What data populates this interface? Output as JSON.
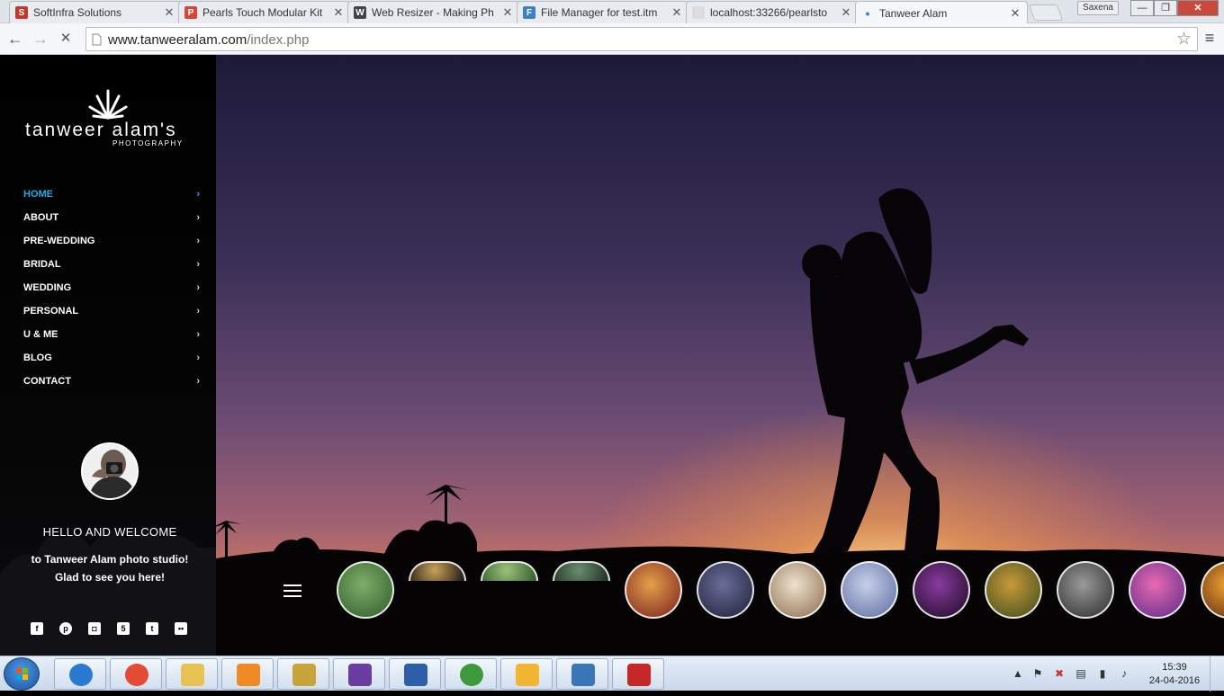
{
  "browser": {
    "tabs": [
      {
        "title": "SoftInfra Solutions",
        "favicon": "S",
        "favicon_color": "#c0392b"
      },
      {
        "title": "Pearls Touch Modular Kit",
        "favicon": "P",
        "favicon_color": "#d8433a"
      },
      {
        "title": "Web Resizer - Making Ph",
        "favicon": "W",
        "favicon_color": "#444444"
      },
      {
        "title": "File Manager for test.itm",
        "favicon": "F",
        "favicon_color": "#3b7fc4"
      },
      {
        "title": "localhost:33266/pearlsto",
        "favicon": "",
        "favicon_color": "#dddddd"
      },
      {
        "title": "Tanweer Alam",
        "favicon": "•",
        "favicon_color": "#f6f7f9"
      }
    ],
    "active_tab_index": 5,
    "profile_name": "Saxena",
    "window_buttons": {
      "minimize": "—",
      "maximize": "❐",
      "close": "✕"
    },
    "url_host": "www.tanweeralam.com",
    "url_path": "/index.php",
    "back_label": "←",
    "forward_label": "→",
    "reload_label": "✕",
    "star_label": "☆",
    "menu_label": "≡"
  },
  "site": {
    "logo_main": "tanweer alam's",
    "logo_sub": "PHOTOGRAPHY",
    "nav": [
      {
        "label": "HOME",
        "current": true
      },
      {
        "label": "ABOUT"
      },
      {
        "label": "PRE-WEDDING"
      },
      {
        "label": "BRIDAL"
      },
      {
        "label": "WEDDING"
      },
      {
        "label": "PERSONAL"
      },
      {
        "label": "U & ME"
      },
      {
        "label": "BLOG"
      },
      {
        "label": "CONTACT"
      }
    ],
    "nav_chevron": "›",
    "welcome_title": "HELLO AND WELCOME",
    "welcome_text": "to Tanweer Alam photo studio! Glad to see you here!",
    "social": [
      {
        "icon": "facebook-icon",
        "glyph": "f"
      },
      {
        "icon": "pinterest-icon",
        "glyph": "p"
      },
      {
        "icon": "instagram-icon",
        "glyph": "◘"
      },
      {
        "icon": "500px-icon",
        "glyph": "5"
      },
      {
        "icon": "twitter-icon",
        "glyph": "t"
      },
      {
        "icon": "flickr-icon",
        "glyph": "••"
      }
    ],
    "thumbnail_count": 14
  },
  "taskbar": {
    "apps": [
      "internet-explorer",
      "chrome",
      "file-explorer",
      "media-player",
      "tools",
      "visual-studio",
      "media-center",
      "utorrent",
      "outlook",
      "photo-viewer",
      "acrobat"
    ],
    "app_colors": [
      "#2a7ad1",
      "#e34b35",
      "#e8c353",
      "#f08a24",
      "#c9a43a",
      "#6a3ea1",
      "#2d5fa8",
      "#3d9a3a",
      "#f2b632",
      "#3b77b8",
      "#c62828"
    ],
    "time": "15:39",
    "date": "24-04-2016"
  }
}
